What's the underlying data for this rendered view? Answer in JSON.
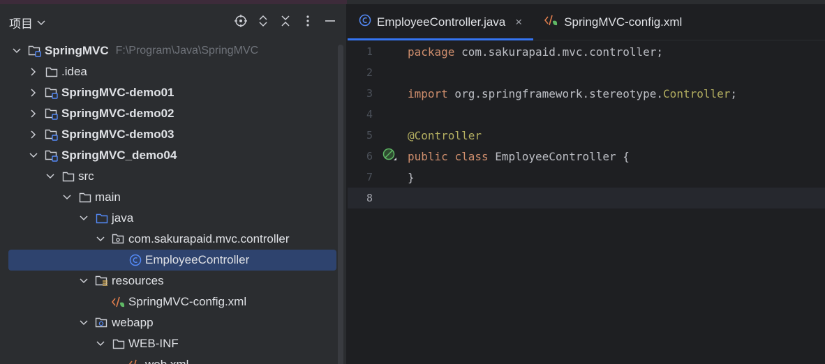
{
  "project_panel": {
    "title": "项目",
    "tree": [
      {
        "label": "SpringMVC",
        "path": "F:\\Program\\Java\\SpringMVC",
        "depth": 0,
        "expanded": true,
        "icon": "module-folder-icon",
        "bold": true
      },
      {
        "label": ".idea",
        "depth": 1,
        "expanded": false,
        "icon": "folder-icon"
      },
      {
        "label": "SpringMVC-demo01",
        "depth": 1,
        "expanded": false,
        "icon": "module-folder-icon",
        "bold": true
      },
      {
        "label": "SpringMVC-demo02",
        "depth": 1,
        "expanded": false,
        "icon": "module-folder-icon",
        "bold": true
      },
      {
        "label": "SpringMVC-demo03",
        "depth": 1,
        "expanded": false,
        "icon": "module-folder-icon",
        "bold": true
      },
      {
        "label": "SpringMVC_demo04",
        "depth": 1,
        "expanded": true,
        "icon": "module-folder-icon",
        "bold": true
      },
      {
        "label": "src",
        "depth": 2,
        "expanded": true,
        "icon": "folder-icon"
      },
      {
        "label": "main",
        "depth": 3,
        "expanded": true,
        "icon": "folder-icon"
      },
      {
        "label": "java",
        "depth": 4,
        "expanded": true,
        "icon": "source-folder-icon"
      },
      {
        "label": "com.sakurapaid.mvc.controller",
        "depth": 5,
        "expanded": true,
        "icon": "package-icon"
      },
      {
        "label": "EmployeeController",
        "depth": 6,
        "icon": "java-class-icon",
        "selected": true
      },
      {
        "label": "resources",
        "depth": 4,
        "expanded": true,
        "icon": "resources-folder-icon"
      },
      {
        "label": "SpringMVC-config.xml",
        "depth": 5,
        "icon": "spring-xml-icon"
      },
      {
        "label": "webapp",
        "depth": 4,
        "expanded": true,
        "icon": "web-folder-icon"
      },
      {
        "label": "WEB-INF",
        "depth": 5,
        "expanded": true,
        "icon": "folder-icon"
      },
      {
        "label": "web.xml",
        "depth": 6,
        "icon": "xml-file-icon"
      }
    ]
  },
  "editor": {
    "tabs": [
      {
        "label": "EmployeeController.java",
        "active": true,
        "icon": "java-class-icon"
      },
      {
        "label": "SpringMVC-config.xml",
        "active": false,
        "icon": "spring-xml-icon"
      }
    ],
    "lines": [
      {
        "n": "1"
      },
      {
        "n": "2"
      },
      {
        "n": "3"
      },
      {
        "n": "4"
      },
      {
        "n": "5"
      },
      {
        "n": "6"
      },
      {
        "n": "7"
      },
      {
        "n": "8"
      }
    ],
    "code": {
      "l1_kw": "package",
      "l1_rest": " com.sakurapaid.mvc.controller;",
      "l3_kw": "import",
      "l3_rest": " org.springframework.stereotype.",
      "l3_cls": "Controller",
      "l3_end": ";",
      "l5_ann": "@Controller",
      "l6_kw1": "public",
      "l6_kw2": "class",
      "l6_rest": " EmployeeController {",
      "l7": "}"
    },
    "current_line": "8"
  },
  "colors": {
    "panel_bg": "#2b2d30",
    "editor_bg": "#1e1f22",
    "selection": "#2e436e",
    "keyword": "#cf8e6d",
    "annotation": "#b3ae60",
    "accent": "#3574f0"
  }
}
